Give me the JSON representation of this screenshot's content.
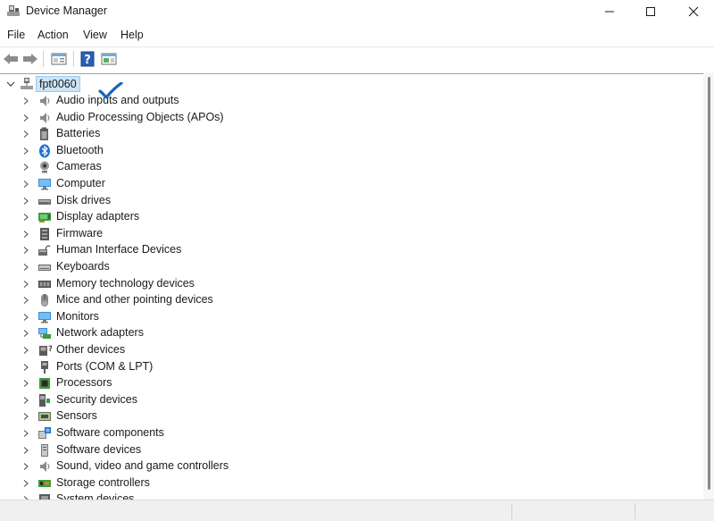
{
  "window": {
    "title": "Device Manager",
    "icon": "device-manager-icon"
  },
  "menu": [
    "File",
    "Action",
    "View",
    "Help"
  ],
  "toolbar": {
    "buttons": [
      "back-arrow-icon",
      "forward-arrow-icon",
      "properties-icon",
      "help-icon",
      "details-pane-icon"
    ]
  },
  "tree": {
    "root": {
      "label": "fpt0060",
      "icon": "computer-network-icon",
      "expanded": true
    },
    "items": [
      {
        "label": "Audio inputs and outputs",
        "icon": "speaker-icon"
      },
      {
        "label": "Audio Processing Objects (APOs)",
        "icon": "speaker-icon"
      },
      {
        "label": "Batteries",
        "icon": "battery-icon"
      },
      {
        "label": "Bluetooth",
        "icon": "bluetooth-icon"
      },
      {
        "label": "Cameras",
        "icon": "webcam-icon"
      },
      {
        "label": "Computer",
        "icon": "monitor-icon"
      },
      {
        "label": "Disk drives",
        "icon": "disk-drive-icon"
      },
      {
        "label": "Display adapters",
        "icon": "display-adapter-icon"
      },
      {
        "label": "Firmware",
        "icon": "firmware-icon"
      },
      {
        "label": "Human Interface Devices",
        "icon": "hid-icon"
      },
      {
        "label": "Keyboards",
        "icon": "keyboard-icon"
      },
      {
        "label": "Memory technology devices",
        "icon": "memory-icon"
      },
      {
        "label": "Mice and other pointing devices",
        "icon": "mouse-icon"
      },
      {
        "label": "Monitors",
        "icon": "monitor-icon"
      },
      {
        "label": "Network adapters",
        "icon": "network-adapter-icon"
      },
      {
        "label": "Other devices",
        "icon": "unknown-device-icon"
      },
      {
        "label": "Ports (COM & LPT)",
        "icon": "port-icon"
      },
      {
        "label": "Processors",
        "icon": "processor-icon"
      },
      {
        "label": "Security devices",
        "icon": "security-device-icon"
      },
      {
        "label": "Sensors",
        "icon": "sensor-icon"
      },
      {
        "label": "Software components",
        "icon": "software-component-icon"
      },
      {
        "label": "Software devices",
        "icon": "software-device-icon"
      },
      {
        "label": "Sound, video and game controllers",
        "icon": "speaker-icon"
      },
      {
        "label": "Storage controllers",
        "icon": "storage-controller-icon"
      },
      {
        "label": "System devices",
        "icon": "system-device-icon"
      }
    ]
  },
  "annotation": {
    "checked_item": "Cameras",
    "color": "#1565c0"
  },
  "colors": {
    "selection_bg": "#cce4f7",
    "selection_border": "#99c9ef",
    "accent": "#0078d4"
  }
}
